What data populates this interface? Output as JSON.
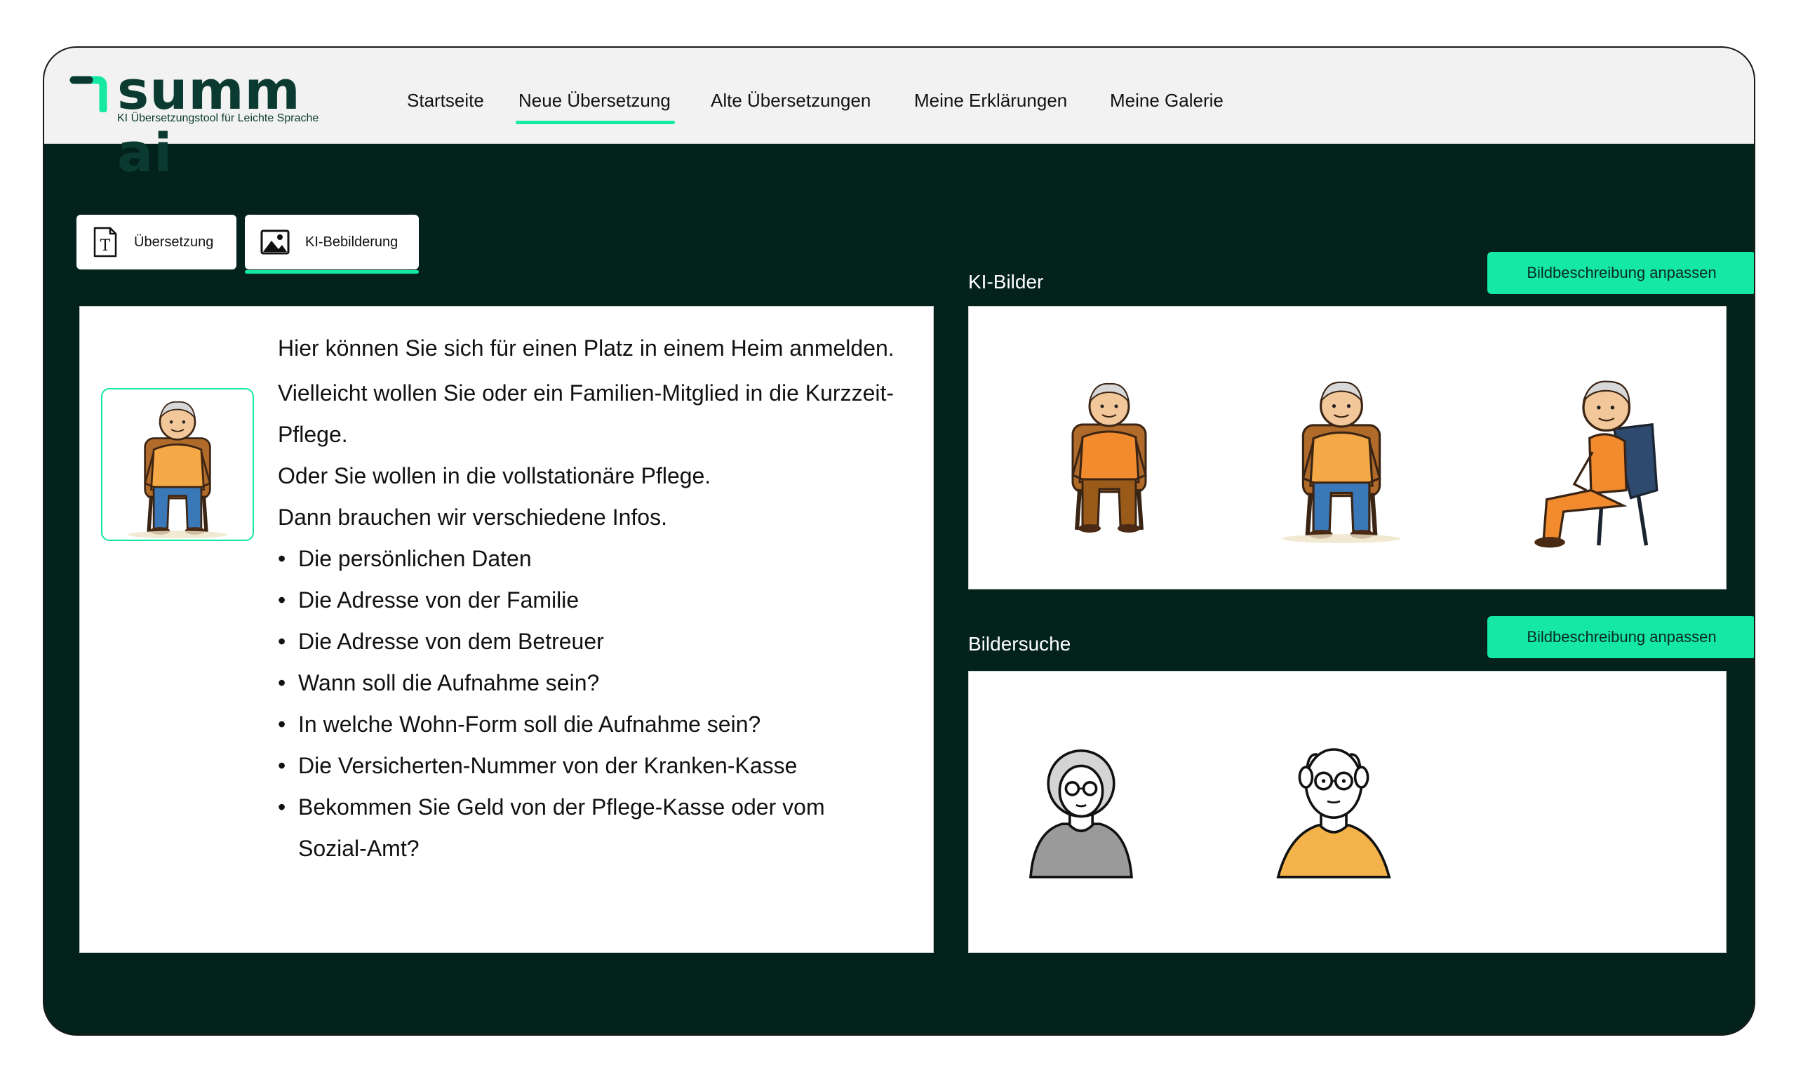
{
  "brand": {
    "name": "summ ai",
    "tagline": "KI Übersetzungstool für Leichte Sprache"
  },
  "nav": [
    {
      "label": "Startseite",
      "active": false
    },
    {
      "label": "Neue Übersetzung",
      "active": true
    },
    {
      "label": "Alte Übersetzungen",
      "active": false
    },
    {
      "label": "Meine Erklärungen",
      "active": false
    },
    {
      "label": "Meine Galerie",
      "active": false
    }
  ],
  "tabs": [
    {
      "label": "Übersetzung",
      "icon": "text-document-icon",
      "active": false
    },
    {
      "label": "KI-Bebilderung",
      "icon": "image-icon",
      "active": true
    }
  ],
  "content": {
    "lines": [
      "Hier können Sie sich für einen Platz in einem Heim anmelden.",
      "Vielleicht wollen Sie oder ein Familien-Mitglied in die Kurzzeit-Pflege.",
      "Oder Sie wollen in die vollstationäre Pflege.",
      "Dann brauchen wir verschiedene Infos."
    ],
    "bullets": [
      "Die persönlichen Daten",
      "Die Adresse von der Familie",
      "Die Adresse von dem Betreuer",
      "Wann soll die Aufnahme sein?",
      "In welche Wohn-Form soll die Aufnahme sein?",
      "Die Versicherten-Nummer von der Kranken-Kasse",
      "Bekommen Sie Geld von der Pflege-Kasse oder vom Sozial-Amt?"
    ]
  },
  "ki_bilder": {
    "title": "KI-Bilder",
    "button": "Bildbeschreibung anpassen"
  },
  "bildersuche": {
    "title": "Bildersuche",
    "button": "Bildbeschreibung anpassen"
  },
  "colors": {
    "accent": "#14e8a2",
    "background": "#03221c",
    "brand": "#0b3b30"
  }
}
